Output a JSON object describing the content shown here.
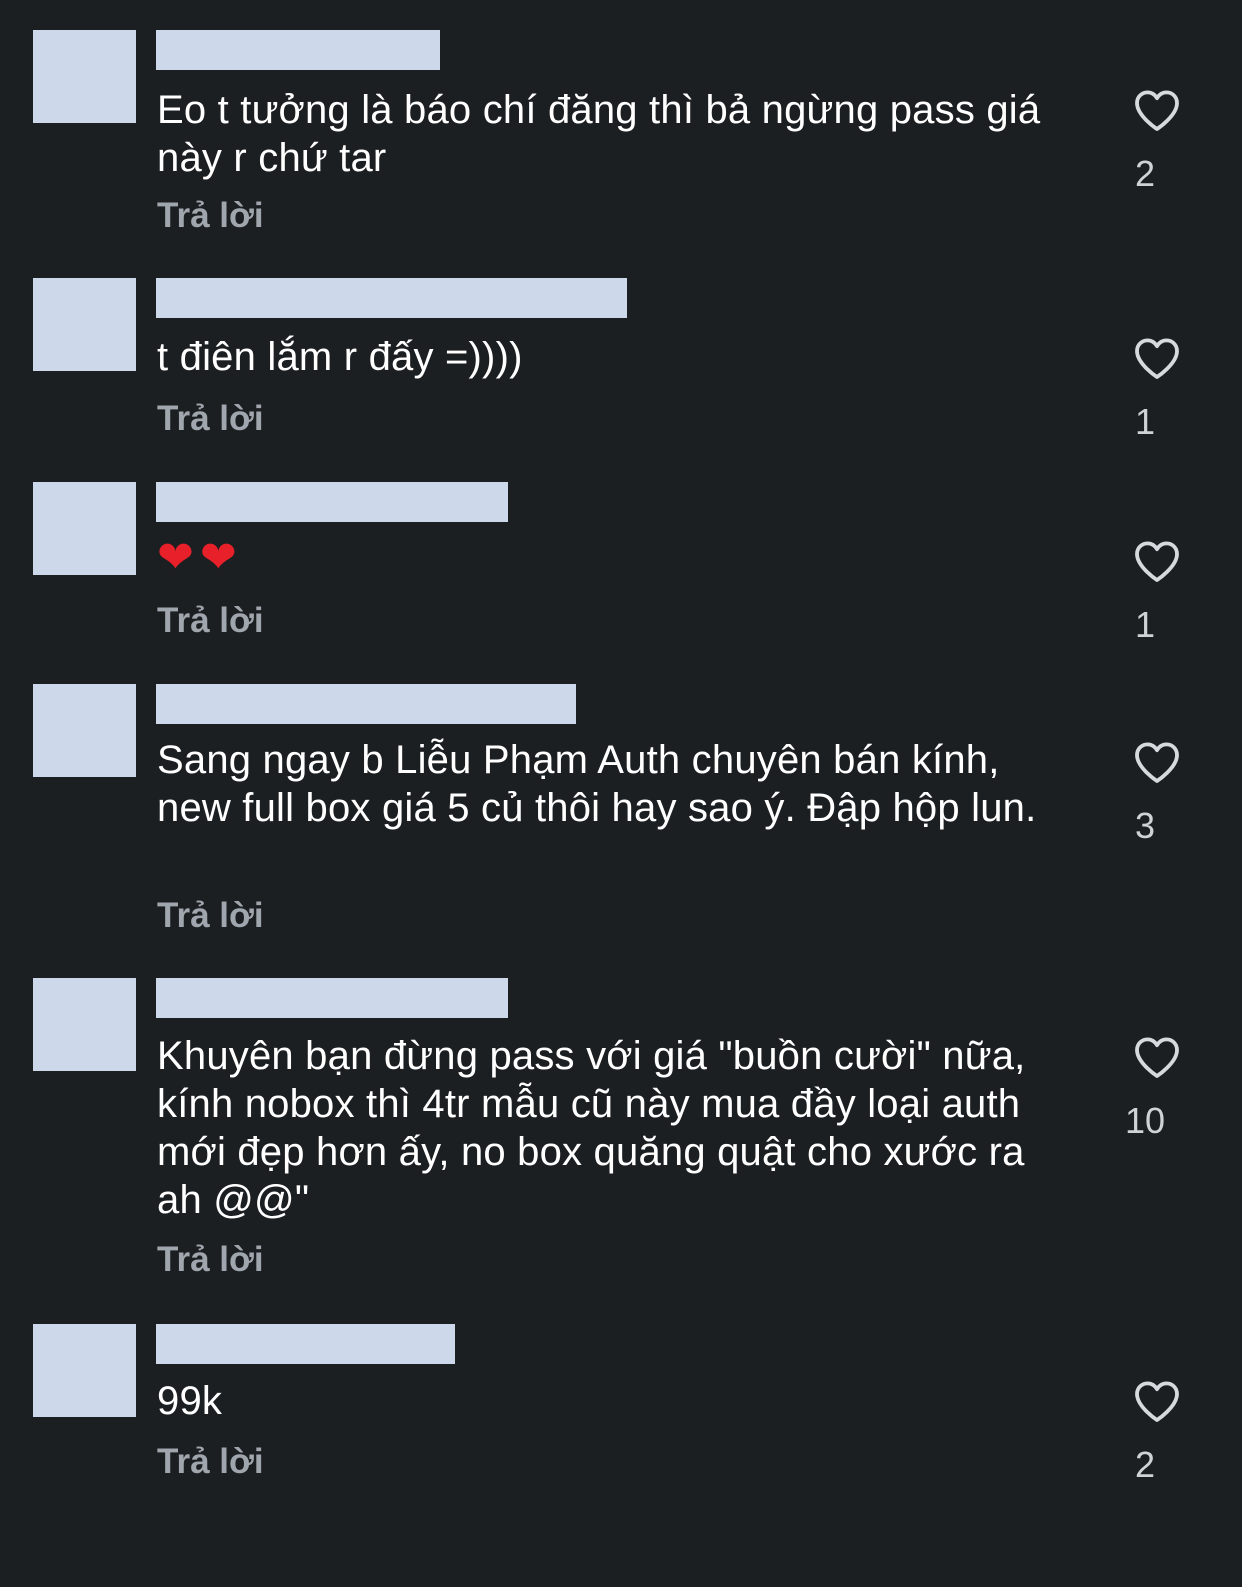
{
  "comments": [
    {
      "text": "Eo t tưởng là báo chí đăng thì bả ngừng pass giá này r chứ tar",
      "reply": "Trả lời",
      "likes": "2"
    },
    {
      "text": "t điên lắm r đấy =))))",
      "reply": "Trả lời",
      "likes": "1"
    },
    {
      "text": "❤❤",
      "reply": "Trả lời",
      "likes": "1"
    },
    {
      "text": "Sang ngay b Liễu Phạm Auth chuyên bán kính, new full box giá 5 củ thôi hay sao ý. Đập hộp lun.",
      "reply": "Trả lời",
      "likes": "3"
    },
    {
      "text": "Khuyên bạn đừng pass với giá \"buồn cười\" nữa, kính nobox thì 4tr mẫu cũ này mua đầy loại auth mới đẹp hơn ấy, no box quăng quật cho xước ra ah @@\"",
      "reply": "Trả lời",
      "likes": "10"
    },
    {
      "text": "99k",
      "reply": "Trả lời",
      "likes": "2"
    }
  ],
  "icons": {
    "like": "heart-outline-icon",
    "emoji": "red-heart-emoji"
  },
  "colors": {
    "background": "#1c1f22",
    "redacted": "#cdd9ea",
    "secondary_text": "#a0a6ad",
    "emoji_red": "#e8202a"
  }
}
